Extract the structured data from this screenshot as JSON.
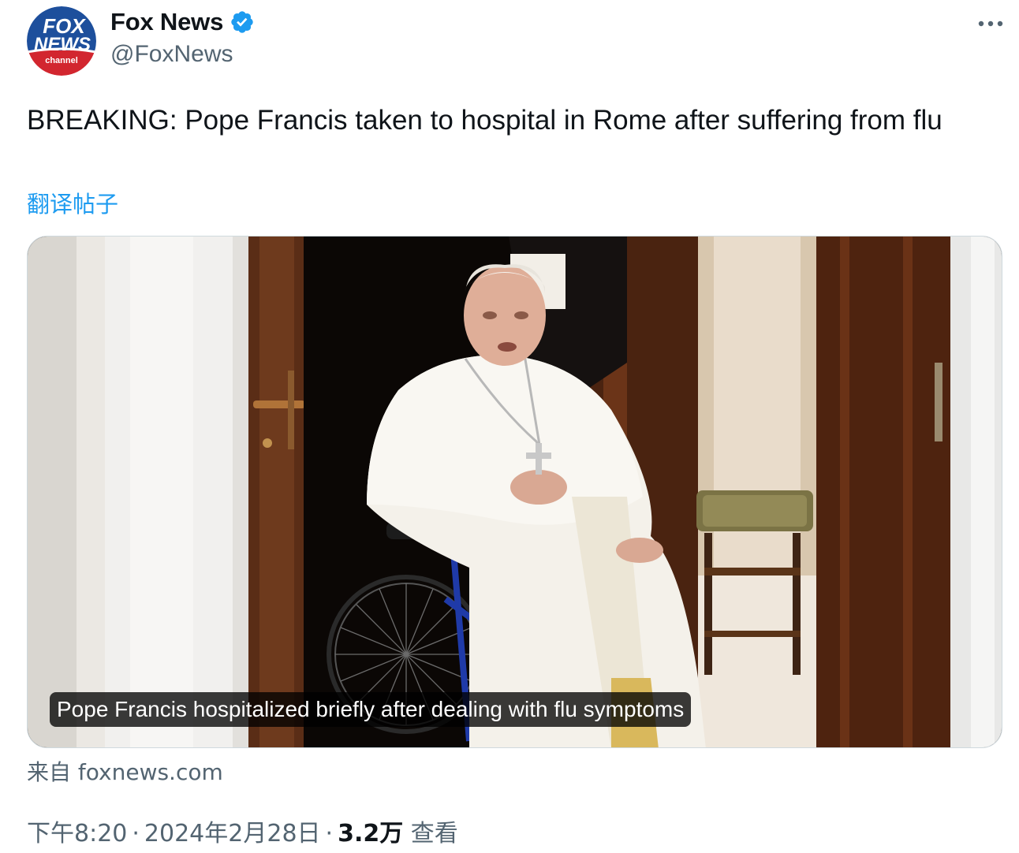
{
  "tweet": {
    "author": {
      "display_name": "Fox News",
      "handle": "@FoxNews",
      "verified": true,
      "avatar_logo": {
        "line1": "FOX",
        "line2": "NEWS",
        "line3": "channel"
      }
    },
    "more_icon": "more-horizontal-icon",
    "text": "BREAKING: Pope Francis taken to hospital in Rome after suffering from flu",
    "translate_label": "翻译帖子",
    "media": {
      "caption": "Pope Francis hospitalized briefly after dealing with flu symptoms"
    },
    "source": "来自 foxnews.com",
    "meta": {
      "time": "下午8:20",
      "separator": "·",
      "date": "2024年2月28日",
      "views_count": "3.2万",
      "views_label": "查看"
    }
  },
  "colors": {
    "text_primary": "#0f1419",
    "text_secondary": "#536471",
    "link_blue": "#1d9bf0",
    "verified_blue": "#1d9bf0"
  }
}
